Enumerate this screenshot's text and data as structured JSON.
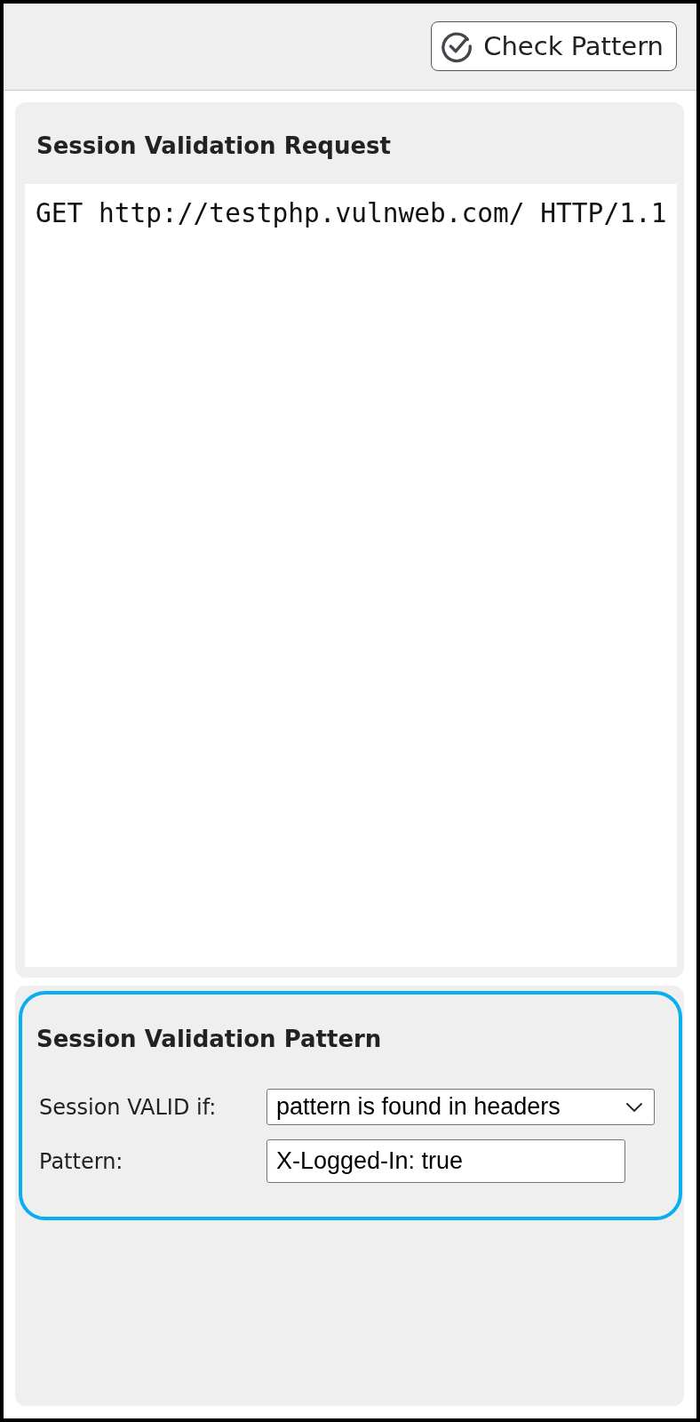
{
  "toolbar": {
    "check_button": {
      "label": "Check Pattern"
    }
  },
  "request_panel": {
    "title": "Session Validation Request",
    "request_text": "GET http://testphp.vulnweb.com/ HTTP/1.1"
  },
  "pattern_panel": {
    "title": "Session Validation Pattern",
    "focused": true,
    "fields": [
      {
        "kind": "select",
        "label": "Session VALID if:",
        "value": "pattern is found in headers"
      },
      {
        "kind": "text",
        "label": "Pattern:",
        "value": "X-Logged-In: true"
      }
    ]
  }
}
